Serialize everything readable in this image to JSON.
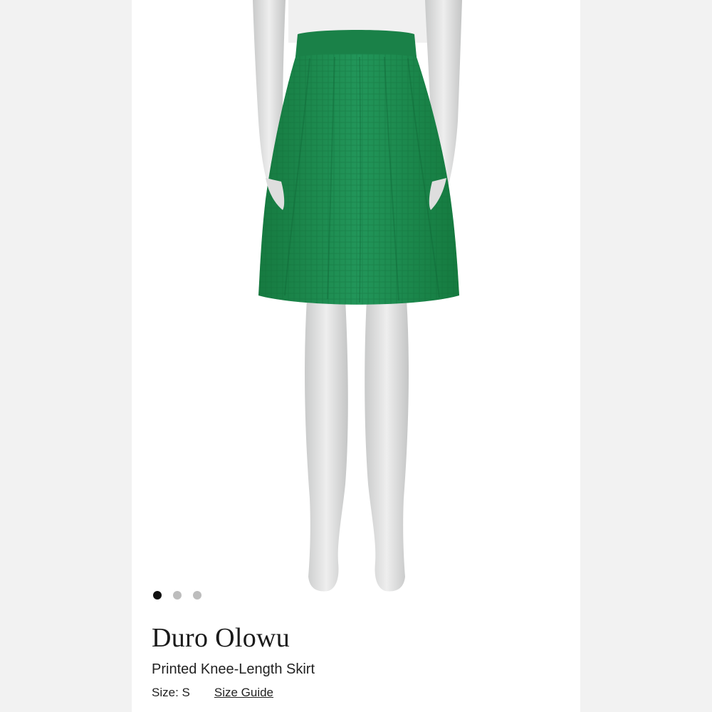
{
  "product": {
    "brand": "Duro Olowu",
    "title": "Printed Knee-Length Skirt",
    "size_label": "Size: S",
    "size_guide_label": "Size Guide",
    "image_icon": "green-skirt-on-mannequin-image"
  },
  "carousel": {
    "dot_count": 3,
    "active_index": 0
  },
  "colors": {
    "skirt_green": "#1e8a4c",
    "mannequin_gray": "#d7d8d8"
  }
}
